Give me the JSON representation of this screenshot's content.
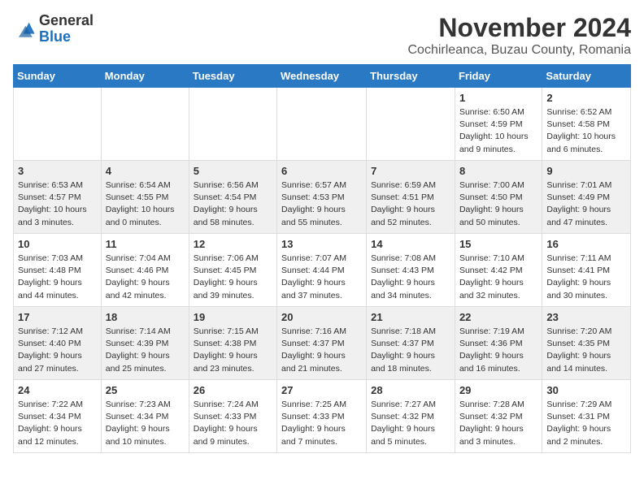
{
  "header": {
    "logo_general": "General",
    "logo_blue": "Blue",
    "month_title": "November 2024",
    "location": "Cochirleanca, Buzau County, Romania"
  },
  "days_of_week": [
    "Sunday",
    "Monday",
    "Tuesday",
    "Wednesday",
    "Thursday",
    "Friday",
    "Saturday"
  ],
  "weeks": [
    {
      "cells": [
        {
          "day": null
        },
        {
          "day": null
        },
        {
          "day": null
        },
        {
          "day": null
        },
        {
          "day": null
        },
        {
          "day": "1",
          "sunrise": "Sunrise: 6:50 AM",
          "sunset": "Sunset: 4:59 PM",
          "daylight": "Daylight: 10 hours and 9 minutes."
        },
        {
          "day": "2",
          "sunrise": "Sunrise: 6:52 AM",
          "sunset": "Sunset: 4:58 PM",
          "daylight": "Daylight: 10 hours and 6 minutes."
        }
      ]
    },
    {
      "cells": [
        {
          "day": "3",
          "sunrise": "Sunrise: 6:53 AM",
          "sunset": "Sunset: 4:57 PM",
          "daylight": "Daylight: 10 hours and 3 minutes."
        },
        {
          "day": "4",
          "sunrise": "Sunrise: 6:54 AM",
          "sunset": "Sunset: 4:55 PM",
          "daylight": "Daylight: 10 hours and 0 minutes."
        },
        {
          "day": "5",
          "sunrise": "Sunrise: 6:56 AM",
          "sunset": "Sunset: 4:54 PM",
          "daylight": "Daylight: 9 hours and 58 minutes."
        },
        {
          "day": "6",
          "sunrise": "Sunrise: 6:57 AM",
          "sunset": "Sunset: 4:53 PM",
          "daylight": "Daylight: 9 hours and 55 minutes."
        },
        {
          "day": "7",
          "sunrise": "Sunrise: 6:59 AM",
          "sunset": "Sunset: 4:51 PM",
          "daylight": "Daylight: 9 hours and 52 minutes."
        },
        {
          "day": "8",
          "sunrise": "Sunrise: 7:00 AM",
          "sunset": "Sunset: 4:50 PM",
          "daylight": "Daylight: 9 hours and 50 minutes."
        },
        {
          "day": "9",
          "sunrise": "Sunrise: 7:01 AM",
          "sunset": "Sunset: 4:49 PM",
          "daylight": "Daylight: 9 hours and 47 minutes."
        }
      ]
    },
    {
      "cells": [
        {
          "day": "10",
          "sunrise": "Sunrise: 7:03 AM",
          "sunset": "Sunset: 4:48 PM",
          "daylight": "Daylight: 9 hours and 44 minutes."
        },
        {
          "day": "11",
          "sunrise": "Sunrise: 7:04 AM",
          "sunset": "Sunset: 4:46 PM",
          "daylight": "Daylight: 9 hours and 42 minutes."
        },
        {
          "day": "12",
          "sunrise": "Sunrise: 7:06 AM",
          "sunset": "Sunset: 4:45 PM",
          "daylight": "Daylight: 9 hours and 39 minutes."
        },
        {
          "day": "13",
          "sunrise": "Sunrise: 7:07 AM",
          "sunset": "Sunset: 4:44 PM",
          "daylight": "Daylight: 9 hours and 37 minutes."
        },
        {
          "day": "14",
          "sunrise": "Sunrise: 7:08 AM",
          "sunset": "Sunset: 4:43 PM",
          "daylight": "Daylight: 9 hours and 34 minutes."
        },
        {
          "day": "15",
          "sunrise": "Sunrise: 7:10 AM",
          "sunset": "Sunset: 4:42 PM",
          "daylight": "Daylight: 9 hours and 32 minutes."
        },
        {
          "day": "16",
          "sunrise": "Sunrise: 7:11 AM",
          "sunset": "Sunset: 4:41 PM",
          "daylight": "Daylight: 9 hours and 30 minutes."
        }
      ]
    },
    {
      "cells": [
        {
          "day": "17",
          "sunrise": "Sunrise: 7:12 AM",
          "sunset": "Sunset: 4:40 PM",
          "daylight": "Daylight: 9 hours and 27 minutes."
        },
        {
          "day": "18",
          "sunrise": "Sunrise: 7:14 AM",
          "sunset": "Sunset: 4:39 PM",
          "daylight": "Daylight: 9 hours and 25 minutes."
        },
        {
          "day": "19",
          "sunrise": "Sunrise: 7:15 AM",
          "sunset": "Sunset: 4:38 PM",
          "daylight": "Daylight: 9 hours and 23 minutes."
        },
        {
          "day": "20",
          "sunrise": "Sunrise: 7:16 AM",
          "sunset": "Sunset: 4:37 PM",
          "daylight": "Daylight: 9 hours and 21 minutes."
        },
        {
          "day": "21",
          "sunrise": "Sunrise: 7:18 AM",
          "sunset": "Sunset: 4:37 PM",
          "daylight": "Daylight: 9 hours and 18 minutes."
        },
        {
          "day": "22",
          "sunrise": "Sunrise: 7:19 AM",
          "sunset": "Sunset: 4:36 PM",
          "daylight": "Daylight: 9 hours and 16 minutes."
        },
        {
          "day": "23",
          "sunrise": "Sunrise: 7:20 AM",
          "sunset": "Sunset: 4:35 PM",
          "daylight": "Daylight: 9 hours and 14 minutes."
        }
      ]
    },
    {
      "cells": [
        {
          "day": "24",
          "sunrise": "Sunrise: 7:22 AM",
          "sunset": "Sunset: 4:34 PM",
          "daylight": "Daylight: 9 hours and 12 minutes."
        },
        {
          "day": "25",
          "sunrise": "Sunrise: 7:23 AM",
          "sunset": "Sunset: 4:34 PM",
          "daylight": "Daylight: 9 hours and 10 minutes."
        },
        {
          "day": "26",
          "sunrise": "Sunrise: 7:24 AM",
          "sunset": "Sunset: 4:33 PM",
          "daylight": "Daylight: 9 hours and 9 minutes."
        },
        {
          "day": "27",
          "sunrise": "Sunrise: 7:25 AM",
          "sunset": "Sunset: 4:33 PM",
          "daylight": "Daylight: 9 hours and 7 minutes."
        },
        {
          "day": "28",
          "sunrise": "Sunrise: 7:27 AM",
          "sunset": "Sunset: 4:32 PM",
          "daylight": "Daylight: 9 hours and 5 minutes."
        },
        {
          "day": "29",
          "sunrise": "Sunrise: 7:28 AM",
          "sunset": "Sunset: 4:32 PM",
          "daylight": "Daylight: 9 hours and 3 minutes."
        },
        {
          "day": "30",
          "sunrise": "Sunrise: 7:29 AM",
          "sunset": "Sunset: 4:31 PM",
          "daylight": "Daylight: 9 hours and 2 minutes."
        }
      ]
    }
  ]
}
